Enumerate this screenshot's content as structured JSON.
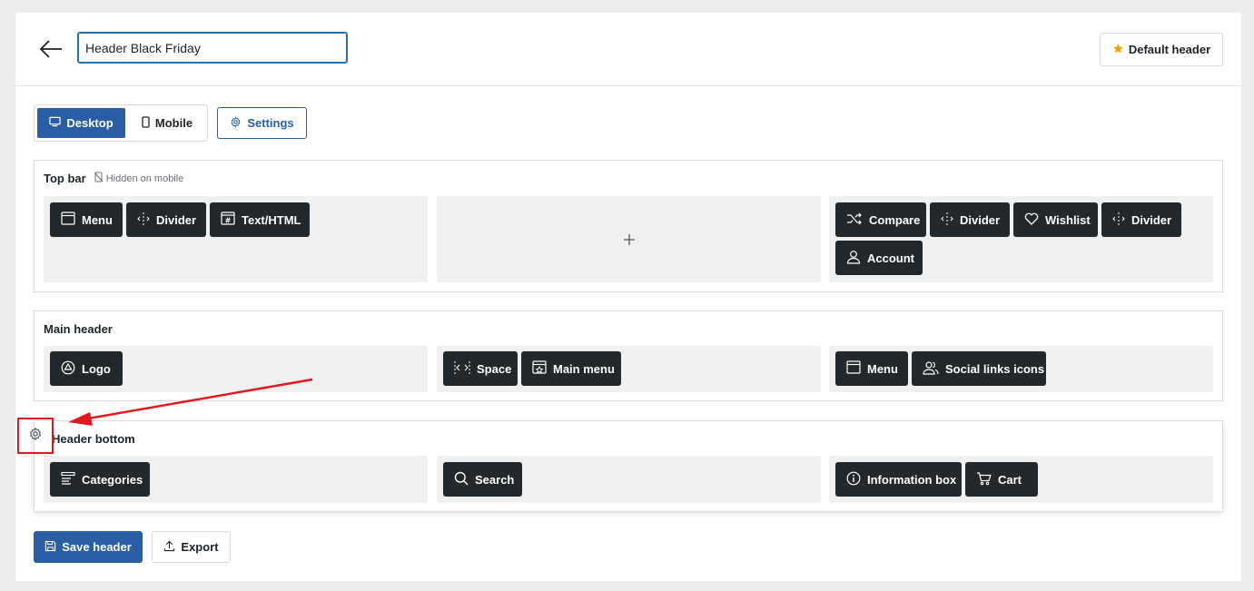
{
  "header": {
    "title_value": "Header Black Friday",
    "default_label": "Default header"
  },
  "toolbar": {
    "desktop_label": "Desktop",
    "mobile_label": "Mobile",
    "settings_label": "Settings"
  },
  "rows": [
    {
      "title": "Top bar",
      "note": "Hidden on mobile",
      "left": [
        {
          "label": "Menu",
          "icon": "menu-window-icon"
        },
        {
          "label": "Divider",
          "icon": "divider-icon"
        },
        {
          "label": "Text/HTML",
          "icon": "text-html-icon"
        }
      ],
      "right": [
        {
          "label": "Compare",
          "icon": "shuffle-icon"
        },
        {
          "label": "Divider",
          "icon": "divider-icon"
        },
        {
          "label": "Wishlist",
          "icon": "heart-icon"
        },
        {
          "label": "Divider",
          "icon": "divider-icon"
        },
        {
          "label": "Account",
          "icon": "user-icon"
        }
      ]
    },
    {
      "title": "Main header",
      "left": [
        {
          "label": "Logo",
          "icon": "logo-icon"
        }
      ],
      "center": [
        {
          "label": "Space",
          "icon": "space-icon"
        },
        {
          "label": "Main menu",
          "icon": "main-menu-icon"
        }
      ],
      "right": [
        {
          "label": "Menu",
          "icon": "menu-window-icon"
        },
        {
          "label": "Social links icons",
          "icon": "users-icon"
        }
      ]
    },
    {
      "title": "Header bottom",
      "left": [
        {
          "label": "Categories",
          "icon": "categories-icon"
        }
      ],
      "center": [
        {
          "label": "Search",
          "icon": "search-icon"
        }
      ],
      "right": [
        {
          "label": "Information box",
          "icon": "info-icon"
        },
        {
          "label": "Cart",
          "icon": "cart-icon"
        }
      ]
    }
  ],
  "footer": {
    "save_label": "Save header",
    "export_label": "Export"
  },
  "colors": {
    "primary": "#2a5ea4",
    "chip_bg": "#23282d",
    "zone_bg": "#f0f0f1",
    "annotation_red": "#e0191f",
    "star": "#f0a30a"
  }
}
